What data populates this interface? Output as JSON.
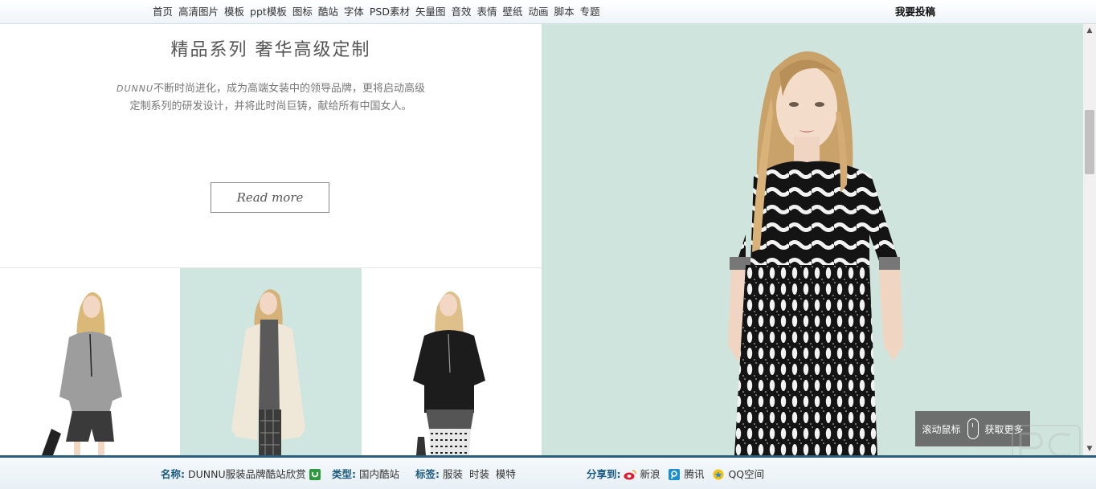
{
  "nav": {
    "items": [
      "首页",
      "高清图片",
      "模板",
      "ppt模板",
      "图标",
      "酷站",
      "字体",
      "PSD素材",
      "矢量图",
      "音效",
      "表情",
      "壁纸",
      "动画",
      "脚本",
      "专题"
    ],
    "contribute": "我要投稿"
  },
  "hero": {
    "title": "精品系列 奢华高级定制",
    "brand": "DUNNU",
    "desc_line1": "不断时尚进化，成为高端女装中的领导品牌，更将启动高级",
    "desc_line2": "定制系列的研发设计，并将此时尚巨铸，献给所有中国女人。",
    "read_more": "Read more"
  },
  "scroll_hint": {
    "left": "滚动鼠标",
    "right": "获取更多"
  },
  "footer": {
    "name_label": "名称:",
    "name_value": "DUNNU服装品牌酷站欣赏",
    "type_label": "类型:",
    "type_value": "国内酷站",
    "tags_label": "标签:",
    "tags": [
      "服装",
      "时装",
      "模特"
    ],
    "share_label": "分享到:",
    "share": [
      "新浪",
      "腾讯",
      "QQ空间"
    ]
  },
  "colors": {
    "accent": "#2a5d7a",
    "mint": "#cfe4dd",
    "label_blue": "#1b5a80"
  }
}
